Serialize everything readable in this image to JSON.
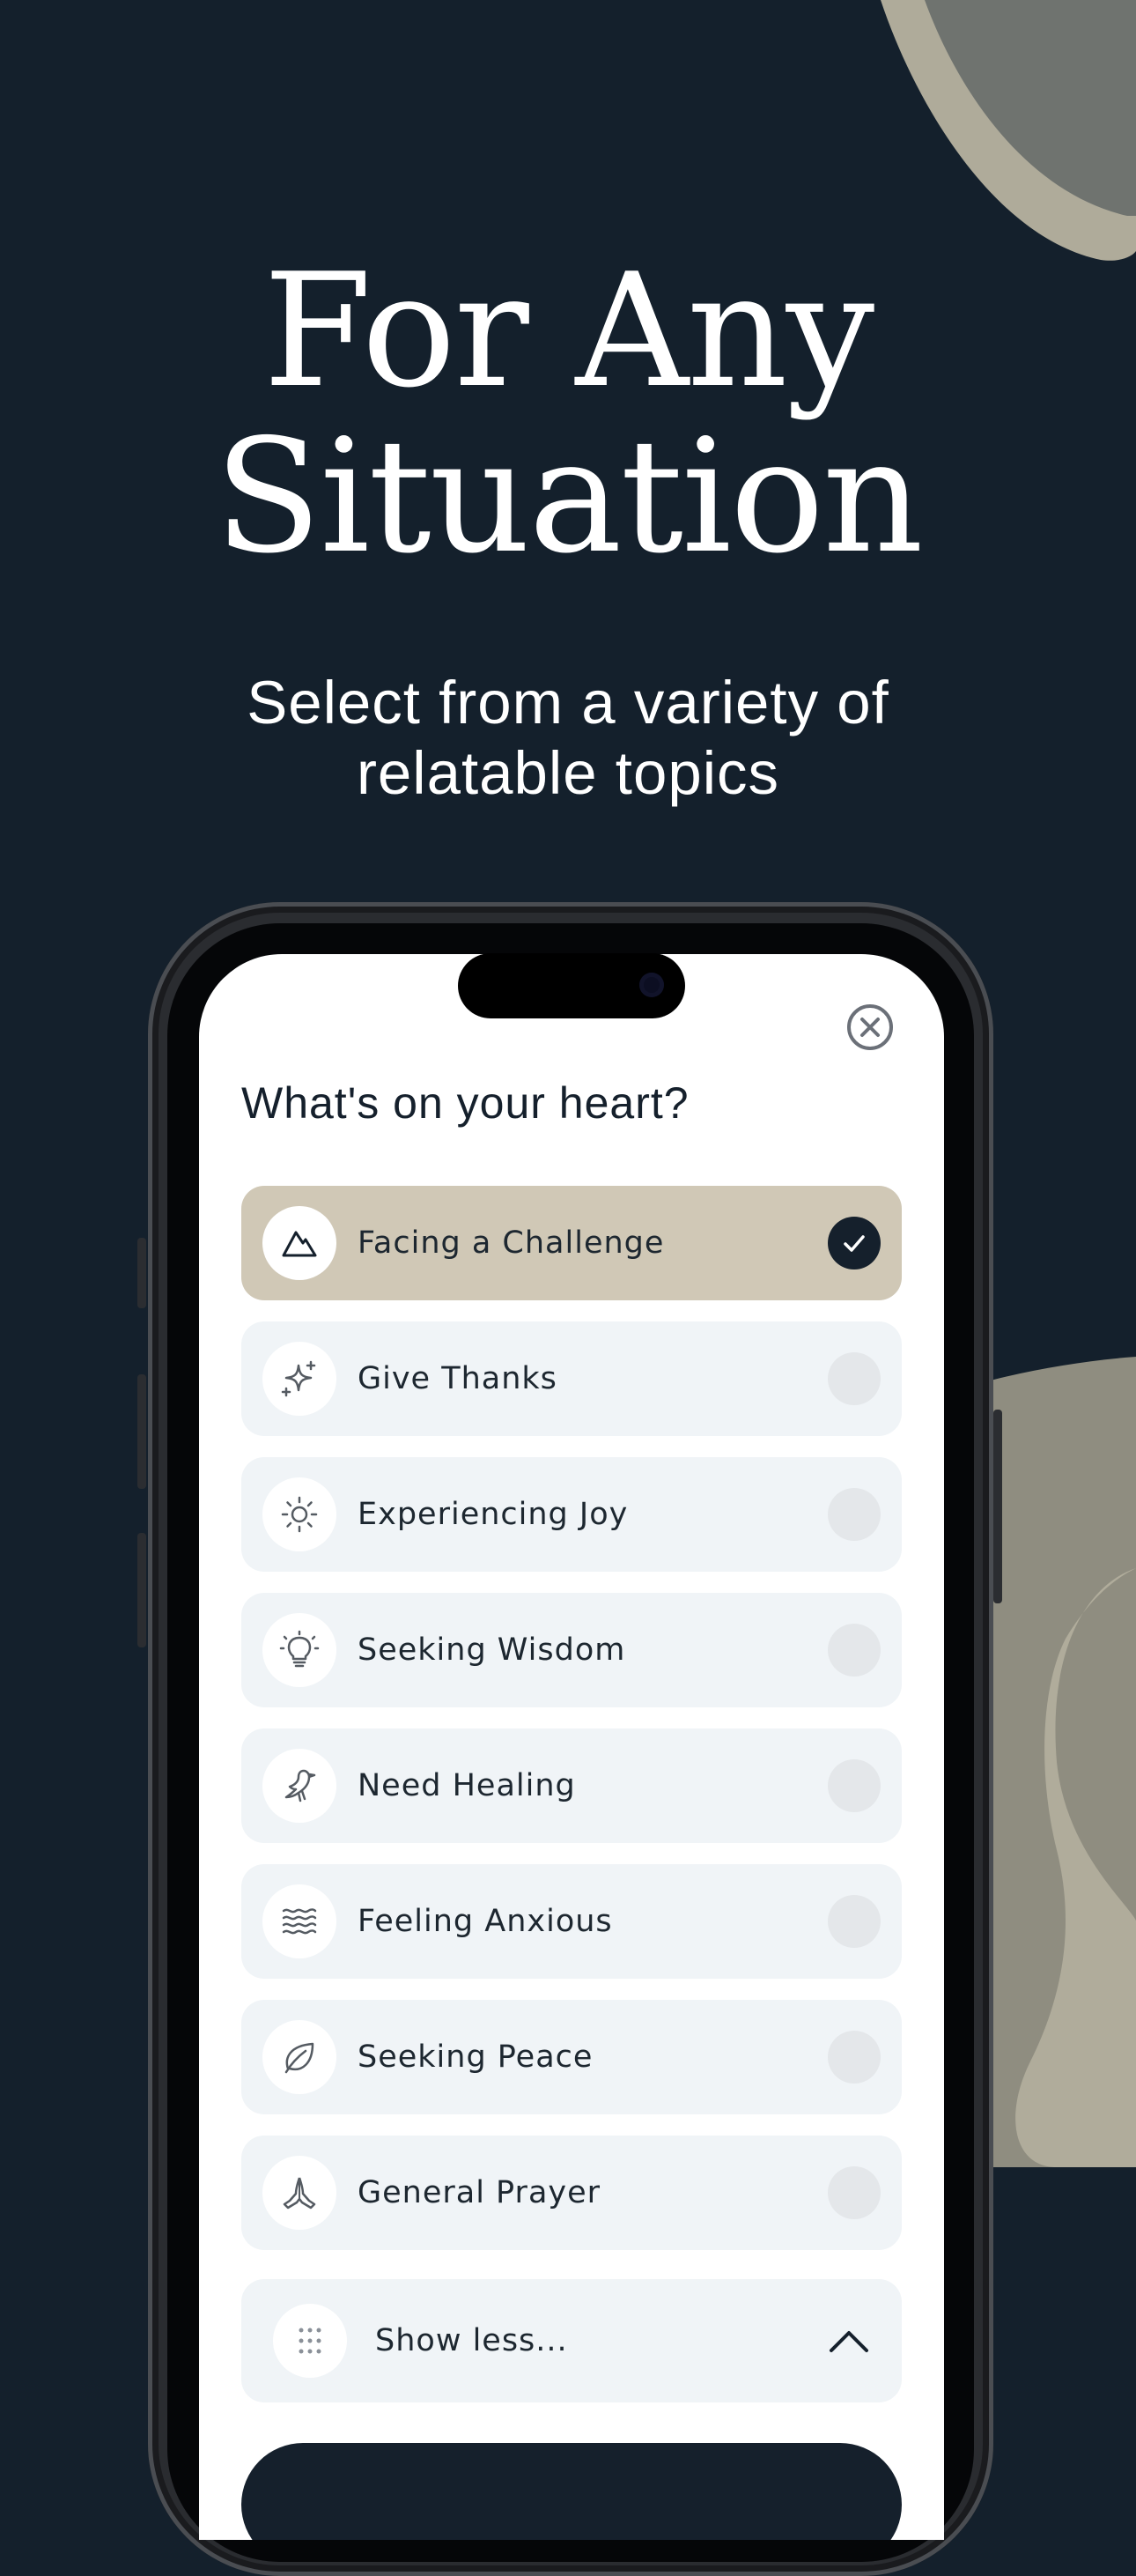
{
  "hero": {
    "headline_line1": "For Any",
    "headline_line2": "Situation",
    "subhead_line1": "Select from a variety of",
    "subhead_line2": "relatable topics"
  },
  "modal": {
    "title": "What's on your heart?",
    "close_icon": "close-circle-icon",
    "options": [
      {
        "label": "Facing a Challenge",
        "icon": "mountain-icon",
        "selected": true
      },
      {
        "label": "Give Thanks",
        "icon": "sparkle-icon",
        "selected": false
      },
      {
        "label": "Experiencing Joy",
        "icon": "sun-icon",
        "selected": false
      },
      {
        "label": "Seeking Wisdom",
        "icon": "lightbulb-icon",
        "selected": false
      },
      {
        "label": "Need Healing",
        "icon": "bird-icon",
        "selected": false
      },
      {
        "label": "Feeling Anxious",
        "icon": "waves-icon",
        "selected": false
      },
      {
        "label": "Seeking Peace",
        "icon": "leaf-icon",
        "selected": false
      },
      {
        "label": "General Prayer",
        "icon": "praying-hands-icon",
        "selected": false
      }
    ],
    "show_less": {
      "label": "Show less...",
      "icon": "dots-grid-icon",
      "chevron": "chevron-up-icon"
    }
  },
  "colors": {
    "background": "#14202c",
    "accent_tan": "#d0c8b6",
    "blob_sage": "#afab9a",
    "blob_gray": "#6f736f",
    "option_bg": "#f0f4f7",
    "text_dark": "#15202c"
  }
}
